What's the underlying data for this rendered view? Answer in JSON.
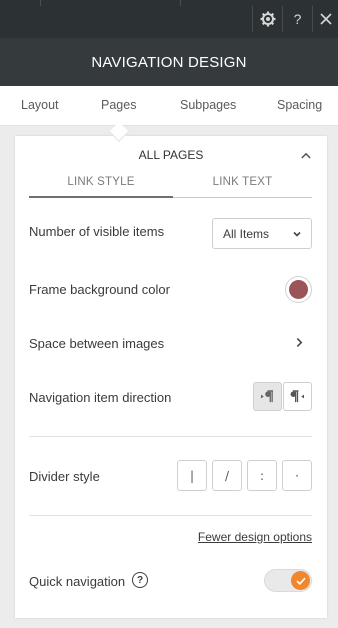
{
  "toolbar": {
    "settings_icon": "gear-icon",
    "help_label": "?",
    "close_icon": "close-icon"
  },
  "header": {
    "title": "NAVIGATION DESIGN"
  },
  "tabs": {
    "items": [
      {
        "label": "Layout"
      },
      {
        "label": "Pages"
      },
      {
        "label": "Subpages"
      },
      {
        "label": "Spacing"
      }
    ],
    "active": "Pages"
  },
  "section": {
    "title": "ALL PAGES",
    "subtabs": [
      {
        "label": "LINK STYLE"
      },
      {
        "label": "LINK TEXT"
      }
    ],
    "active_subtab": "LINK STYLE"
  },
  "settings": {
    "visible_items": {
      "label": "Number of visible items",
      "value": "All Items"
    },
    "frame_bg": {
      "label": "Frame background color",
      "color": "#9b5457"
    },
    "space_images": {
      "label": "Space between images"
    },
    "item_direction": {
      "label": "Navigation item direction",
      "options": [
        "ltr-icon",
        "rtl-icon"
      ],
      "selected": "ltr-icon"
    },
    "divider": {
      "label": "Divider style",
      "options": [
        "|",
        "/",
        ":",
        "·"
      ]
    },
    "fewer_options": "Fewer design options",
    "quick_nav": {
      "label": "Quick navigation",
      "help": "?",
      "enabled": true
    }
  },
  "colors": {
    "topbar": "#2c3133",
    "header": "#353b3d",
    "accent_orange": "#f0862e"
  }
}
